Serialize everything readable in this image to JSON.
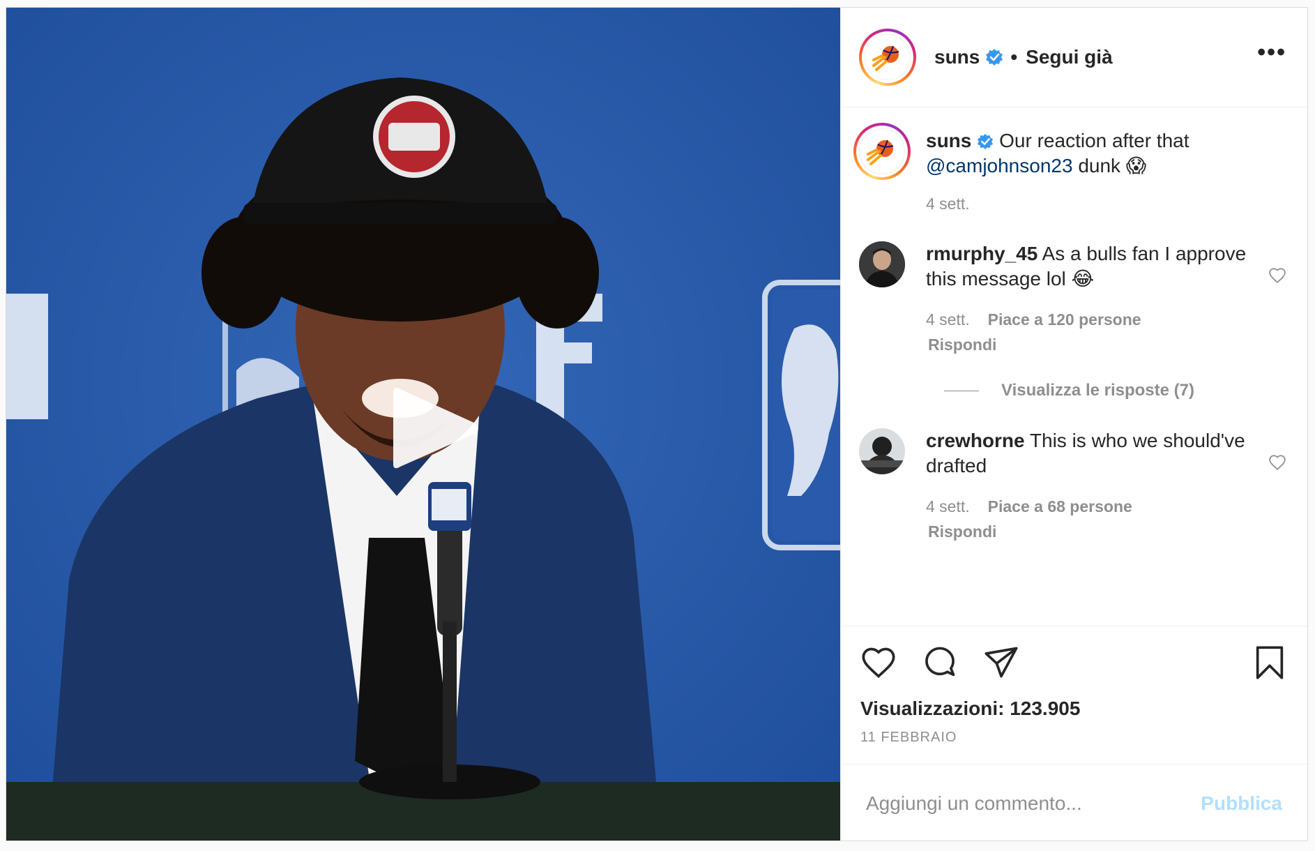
{
  "header": {
    "username": "suns",
    "separator": "•",
    "follow_status": "Segui già",
    "more_label": "•••"
  },
  "caption": {
    "username": "suns",
    "text_before": "Our reaction after that",
    "mention": "@camjohnson23",
    "text_after": "dunk 😱",
    "time": "4 sett."
  },
  "comments": [
    {
      "username": "rmurphy_45",
      "text": "As a bulls fan I approve this message lol 😂",
      "time": "4 sett.",
      "likes": "Piace a 120 persone",
      "reply": "Rispondi",
      "view_replies": "Visualizza le risposte (7)"
    },
    {
      "username": "crewhorne",
      "text": "This is who we should've drafted",
      "time": "4 sett.",
      "likes": "Piace a 68 persone",
      "reply": "Rispondi"
    }
  ],
  "stats": {
    "views": "Visualizzazioni: 123.905",
    "date": "11 FEBBRAIO"
  },
  "add_comment": {
    "placeholder": "Aggiungi un commento...",
    "publish_label": "Pubblica"
  },
  "colors": {
    "link": "#00376b",
    "verified": "#3897f0",
    "muted": "#8e8e8e",
    "publish_disabled": "#b2dffc",
    "media_backdrop": "#2559a8"
  },
  "icons": {
    "like": "heart-icon",
    "comment": "comment-bubble-icon",
    "share": "paper-plane-icon",
    "save": "bookmark-icon",
    "play": "play-icon",
    "verified": "verified-badge-icon",
    "more": "more-options-icon"
  }
}
